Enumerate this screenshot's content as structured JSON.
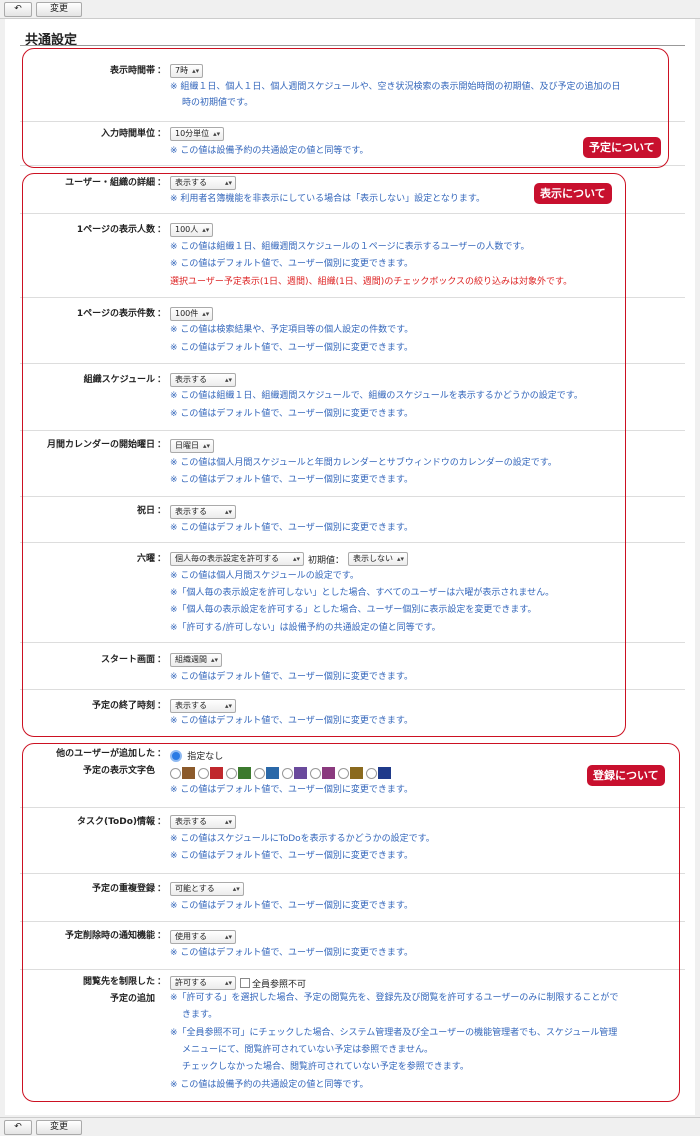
{
  "toolbar": {
    "back_icon": "↶",
    "save_label": "変更"
  },
  "page_title": "共通設定",
  "badges": {
    "schedule": "予定について",
    "display": "表示について",
    "register": "登録について"
  },
  "colors": {
    "highlight_border": "#cc1122",
    "badge_bg": "#c8102e",
    "note_text": "#3366bb",
    "warning_text": "#dd2222",
    "radio_selected": "#2a7be4"
  },
  "settings": {
    "display_hours": {
      "label": "表示時間帯",
      "value": "7時",
      "notes": [
        "※ 組織１日、個人１日、個人週間スケジュールや、空き状況検索の表示開始時間の初期値、及び予定の追加の日",
        "時の初期値です。"
      ]
    },
    "input_unit": {
      "label": "入力時間単位",
      "value": "10分単位",
      "notes": [
        "※ この値は設備予約の共通設定の値と同等です。"
      ]
    },
    "user_detail": {
      "label": "ユーザー・組織の詳細",
      "value": "表示する",
      "notes": [
        "※ 利用者名簿機能を非表示にしている場合は「表示しない」設定となります。"
      ]
    },
    "per_page_users": {
      "label": "1ページの表示人数",
      "value": "100人",
      "notes": [
        "※ この値は組織１日、組織週間スケジュールの１ページに表示するユーザーの人数です。",
        "※ この値はデフォルト値で、ユーザー個別に変更できます。"
      ],
      "warning": "選択ユーザー予定表示(1日、週間)、組織(1日、週間)のチェックボックスの絞り込みは対象外です。"
    },
    "per_page_items": {
      "label": "1ページの表示件数",
      "value": "100件",
      "notes": [
        "※ この値は検索結果や、予定項目等の個人設定の件数です。",
        "※ この値はデフォルト値で、ユーザー個別に変更できます。"
      ]
    },
    "org_schedule": {
      "label": "組織スケジュール",
      "value": "表示する",
      "notes": [
        "※ この値は組織１日、組織週間スケジュールで、組織のスケジュールを表示するかどうかの設定です。",
        "※ この値はデフォルト値で、ユーザー個別に変更できます。"
      ]
    },
    "calendar_start": {
      "label": "月間カレンダーの開始曜日",
      "value": "日曜日",
      "notes": [
        "※ この値は個人月間スケジュールと年間カレンダーとサブウィンドウのカレンダーの設定です。",
        "※ この値はデフォルト値で、ユーザー個別に変更できます。"
      ]
    },
    "holidays": {
      "label": "祝日",
      "value": "表示する",
      "notes": [
        "※ この値はデフォルト値で、ユーザー個別に変更できます。"
      ]
    },
    "rokuyo": {
      "label": "六曜",
      "value": "個人毎の表示設定を許可する",
      "initial_label": "初期値：",
      "initial_value": "表示しない",
      "notes": [
        "※ この値は個人月間スケジュールの設定です。",
        "※「個人毎の表示設定を許可しない」とした場合、すべてのユーザーは六曜が表示されません。",
        "※「個人毎の表示設定を許可する」とした場合、ユーザー個別に表示設定を変更できます。",
        "※「許可する/許可しない」は設備予約の共通設定の値と同等です。"
      ]
    },
    "start_screen": {
      "label": "スタート画面",
      "value": "組織週間",
      "notes": [
        "※ この値はデフォルト値で、ユーザー個別に変更できます。"
      ]
    },
    "end_time": {
      "label": "予定の終了時刻",
      "value": "表示する",
      "notes": [
        "※ この値はデフォルト値で、ユーザー個別に変更できます。"
      ]
    },
    "other_color": {
      "label_line1": "他のユーザーが追加した",
      "label_line2": "予定の表示文字色",
      "none_label": "指定なし",
      "swatches": [
        "#8b5a2b",
        "#c0282d",
        "#3c7a2e",
        "#2a68a8",
        "#6a4a9c",
        "#8a3a7e",
        "#8a6a1e",
        "#1f3a8a"
      ],
      "notes": [
        "※ この値はデフォルト値で、ユーザー個別に変更できます。"
      ]
    },
    "todo_info": {
      "label": "タスク(ToDo)情報",
      "value": "表示する",
      "notes": [
        "※ この値はスケジュールにToDoを表示するかどうかの設定です。",
        "※ この値はデフォルト値で、ユーザー個別に変更できます。"
      ]
    },
    "overlap": {
      "label": "予定の重複登録",
      "value": "可能とする",
      "notes": [
        "※ この値はデフォルト値で、ユーザー個別に変更できます。"
      ]
    },
    "delete_notify": {
      "label": "予定削除時の通知機能",
      "value": "使用する",
      "notes": [
        "※ この値はデフォルト値で、ユーザー個別に変更できます。"
      ]
    },
    "restrict_view": {
      "label_line1": "閲覧先を制限した",
      "label_line2": "予定の追加",
      "value": "許可する",
      "checkbox_label": "全員参照不可",
      "notes": [
        "※「許可する」を選択した場合、予定の閲覧先を、登録先及び閲覧を許可するユーザーのみに制限することがで",
        "きます。",
        "※「全員参照不可」にチェックした場合、システム管理者及び全ユーザーの機能管理者でも、スケジュール管理",
        "メニューにて、閲覧許可されていない予定は参照できません。",
        "チェックしなかった場合、閲覧許可されていない予定を参照できます。",
        "※ この値は設備予約の共通設定の値と同等です。"
      ]
    }
  }
}
